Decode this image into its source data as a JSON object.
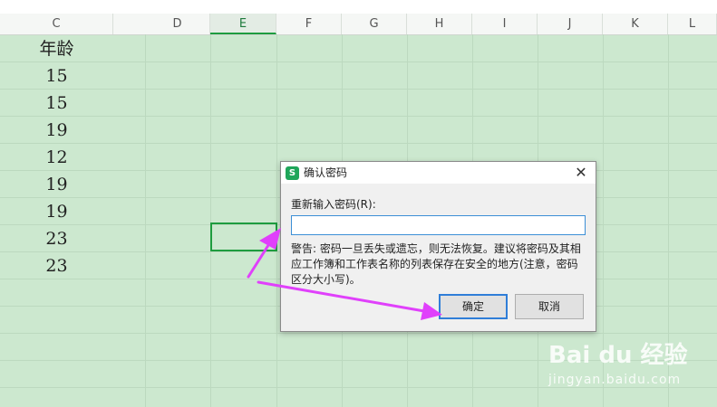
{
  "columns": [
    "C",
    "D",
    "E",
    "F",
    "G",
    "H",
    "I",
    "J",
    "K",
    "L"
  ],
  "selected_column": "E",
  "cells": {
    "header": "年龄",
    "values": [
      "15",
      "15",
      "19",
      "12",
      "19",
      "19",
      "23",
      "23"
    ]
  },
  "dialog": {
    "app_icon": "S",
    "title": "确认密码",
    "close_label": "✕",
    "prompt": "重新输入密码(R):",
    "password_value": "",
    "warning": "警告: 密码一旦丢失或遗忘，则无法恢复。建议将密码及其相应工作簿和工作表名称的列表保存在安全的地方(注意，密码区分大小写)。",
    "ok_label": "确定",
    "cancel_label": "取消"
  },
  "watermark": {
    "logo": "Bai du 经验",
    "sub": "jingyan.baidu.com"
  },
  "colors": {
    "sheet_background": "#cce8cf",
    "selection_green": "#1e9c3f",
    "annotation_arrow": "#e040fb",
    "focus_blue": "#2f7ed8"
  }
}
